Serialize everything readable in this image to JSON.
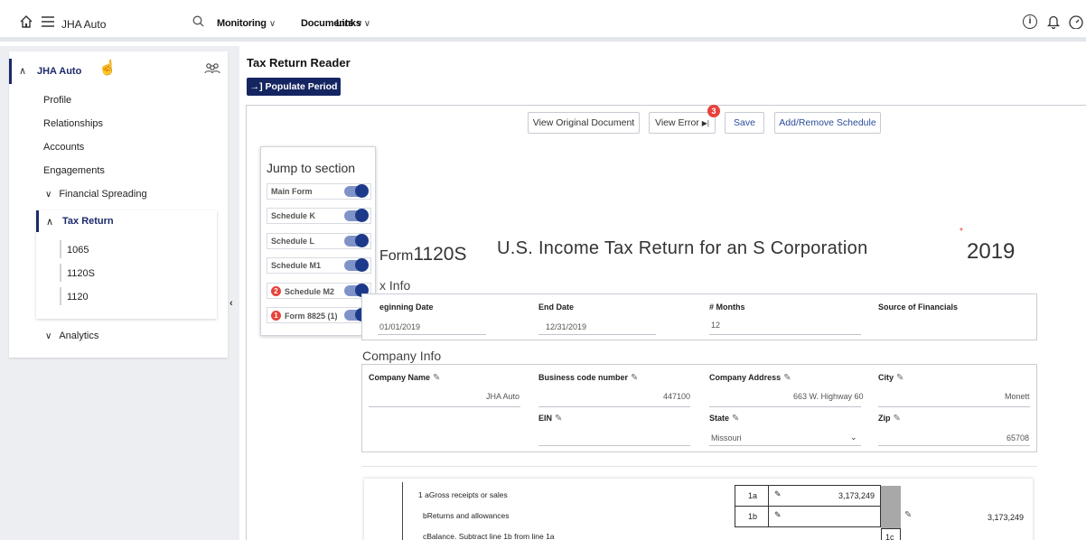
{
  "topbar": {
    "search_value": "JHA Auto",
    "menus": [
      "Monitoring",
      "Documents",
      "Links"
    ]
  },
  "sidebar": {
    "org_name": "JHA Auto",
    "items": [
      "Profile",
      "Relationships",
      "Accounts",
      "Engagements"
    ],
    "financial_spreading": "Financial Spreading",
    "tax_return": "Tax Return",
    "tax_forms": [
      "1065",
      "1120S",
      "1120"
    ],
    "analytics": "Analytics"
  },
  "main": {
    "title": "Tax Return Reader",
    "populate_label": "→] Populate Period",
    "toolbar": {
      "view_original": "View Original Document",
      "view_error": "View Error",
      "error_count": "3",
      "save": "Save",
      "add_remove": "Add/Remove Schedule"
    }
  },
  "jump": {
    "title": "Jump to section",
    "items": [
      {
        "label": "Main Form",
        "badge": ""
      },
      {
        "label": "Schedule K",
        "badge": ""
      },
      {
        "label": "Schedule L",
        "badge": ""
      },
      {
        "label": "Schedule M1",
        "badge": ""
      },
      {
        "label": "Schedule M2",
        "badge": "2"
      },
      {
        "label": "Form 8825 (1)",
        "badge": "1"
      }
    ]
  },
  "form": {
    "form_word": "Form",
    "form_number": "1120S",
    "heading": "U.S. Income Tax Return for an S Corporation",
    "year": "2019",
    "tax_info": {
      "section": "x Info",
      "beginning_label": "eginning Date",
      "beginning_value": "01/01/2019",
      "end_label": "End Date",
      "end_value": "12/31/2019",
      "months_label": "# Months",
      "months_value": "12",
      "source_label": "Source of Financials"
    },
    "company_info": {
      "section": "Company Info",
      "name_label": "Company Name",
      "name_value": "JHA Auto",
      "bcn_label": "Business code number",
      "bcn_value": "447100",
      "address_label": "Company Address",
      "address_value": "663 W. Highway 60",
      "city_label": "City",
      "city_value": "Monett",
      "ein_label": "EIN",
      "state_label": "State",
      "state_value": "Missouri",
      "zip_label": "Zip",
      "zip_value": "65708"
    },
    "schedule": {
      "line1a_num": "1 a",
      "line1a_text": "Gross receipts or sales",
      "line1a_code": "1a",
      "line1a_value": "3,173,249",
      "line1b_num": "b",
      "line1b_text": "Returns and allowances",
      "line1b_code": "1b",
      "line1c_num": "c",
      "line1c_text": "Balance. Subtract line 1b from line 1a",
      "line1c_code": "1c",
      "line1c_value": "3,173,249"
    }
  }
}
